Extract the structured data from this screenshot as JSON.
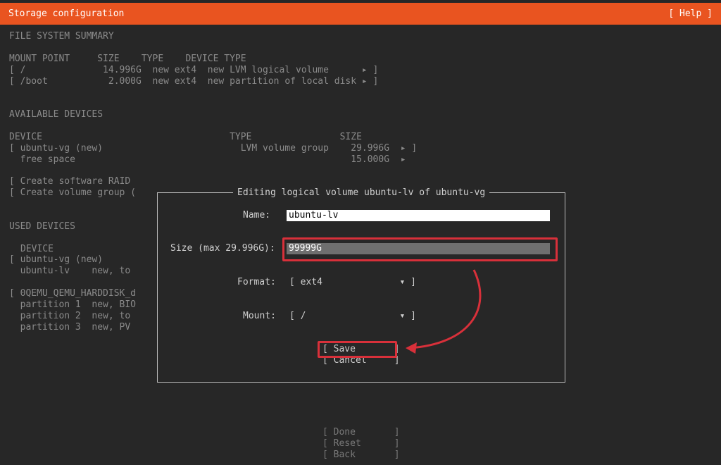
{
  "header": {
    "title": "Storage configuration",
    "help": "[ Help ]"
  },
  "fs_summary": {
    "heading": "FILE SYSTEM SUMMARY",
    "columns": "MOUNT POINT     SIZE    TYPE    DEVICE TYPE",
    "rows": [
      "[ /              14.996G  new ext4  new LVM logical volume      ▸ ]",
      "[ /boot           2.000G  new ext4  new partition of local disk ▸ ]"
    ]
  },
  "available": {
    "heading": "AVAILABLE DEVICES",
    "columns": "DEVICE                                  TYPE                SIZE",
    "rows": [
      "[ ubuntu-vg (new)                         LVM volume group    29.996G  ▸ ]",
      "  free space                                                  15.000G  ▸"
    ],
    "create_raid": "[ Create software RAID",
    "create_vg": "[ Create volume group ("
  },
  "used": {
    "heading": "USED DEVICES",
    "device_col": "DEVICE",
    "rows": [
      "[ ubuntu-vg (new)",
      "  ubuntu-lv    new, to",
      "",
      "[ 0QEMU_QEMU_HARDDISK_d",
      "  partition 1  new, BIO",
      "  partition 2  new, to",
      "  partition 3  new, PV"
    ]
  },
  "dialog": {
    "title": "Editing logical volume ubuntu-lv of ubuntu-vg",
    "name_label": "Name:",
    "name_value": "ubuntu-lv",
    "size_label": "Size (max 29.996G):",
    "size_value": "99999G",
    "format_label": "Format:",
    "format_value": "[ ext4              ▾ ]",
    "mount_label": "Mount:",
    "mount_value": "[ /                 ▾ ]",
    "save": "[ Save       ]",
    "cancel": "[ Cancel     ]"
  },
  "footer": {
    "done": "[ Done       ]",
    "reset": "[ Reset      ]",
    "back": "[ Back       ]"
  },
  "colors": {
    "header_bg": "#e95420",
    "highlight": "#d8303a",
    "bg": "#272727"
  }
}
